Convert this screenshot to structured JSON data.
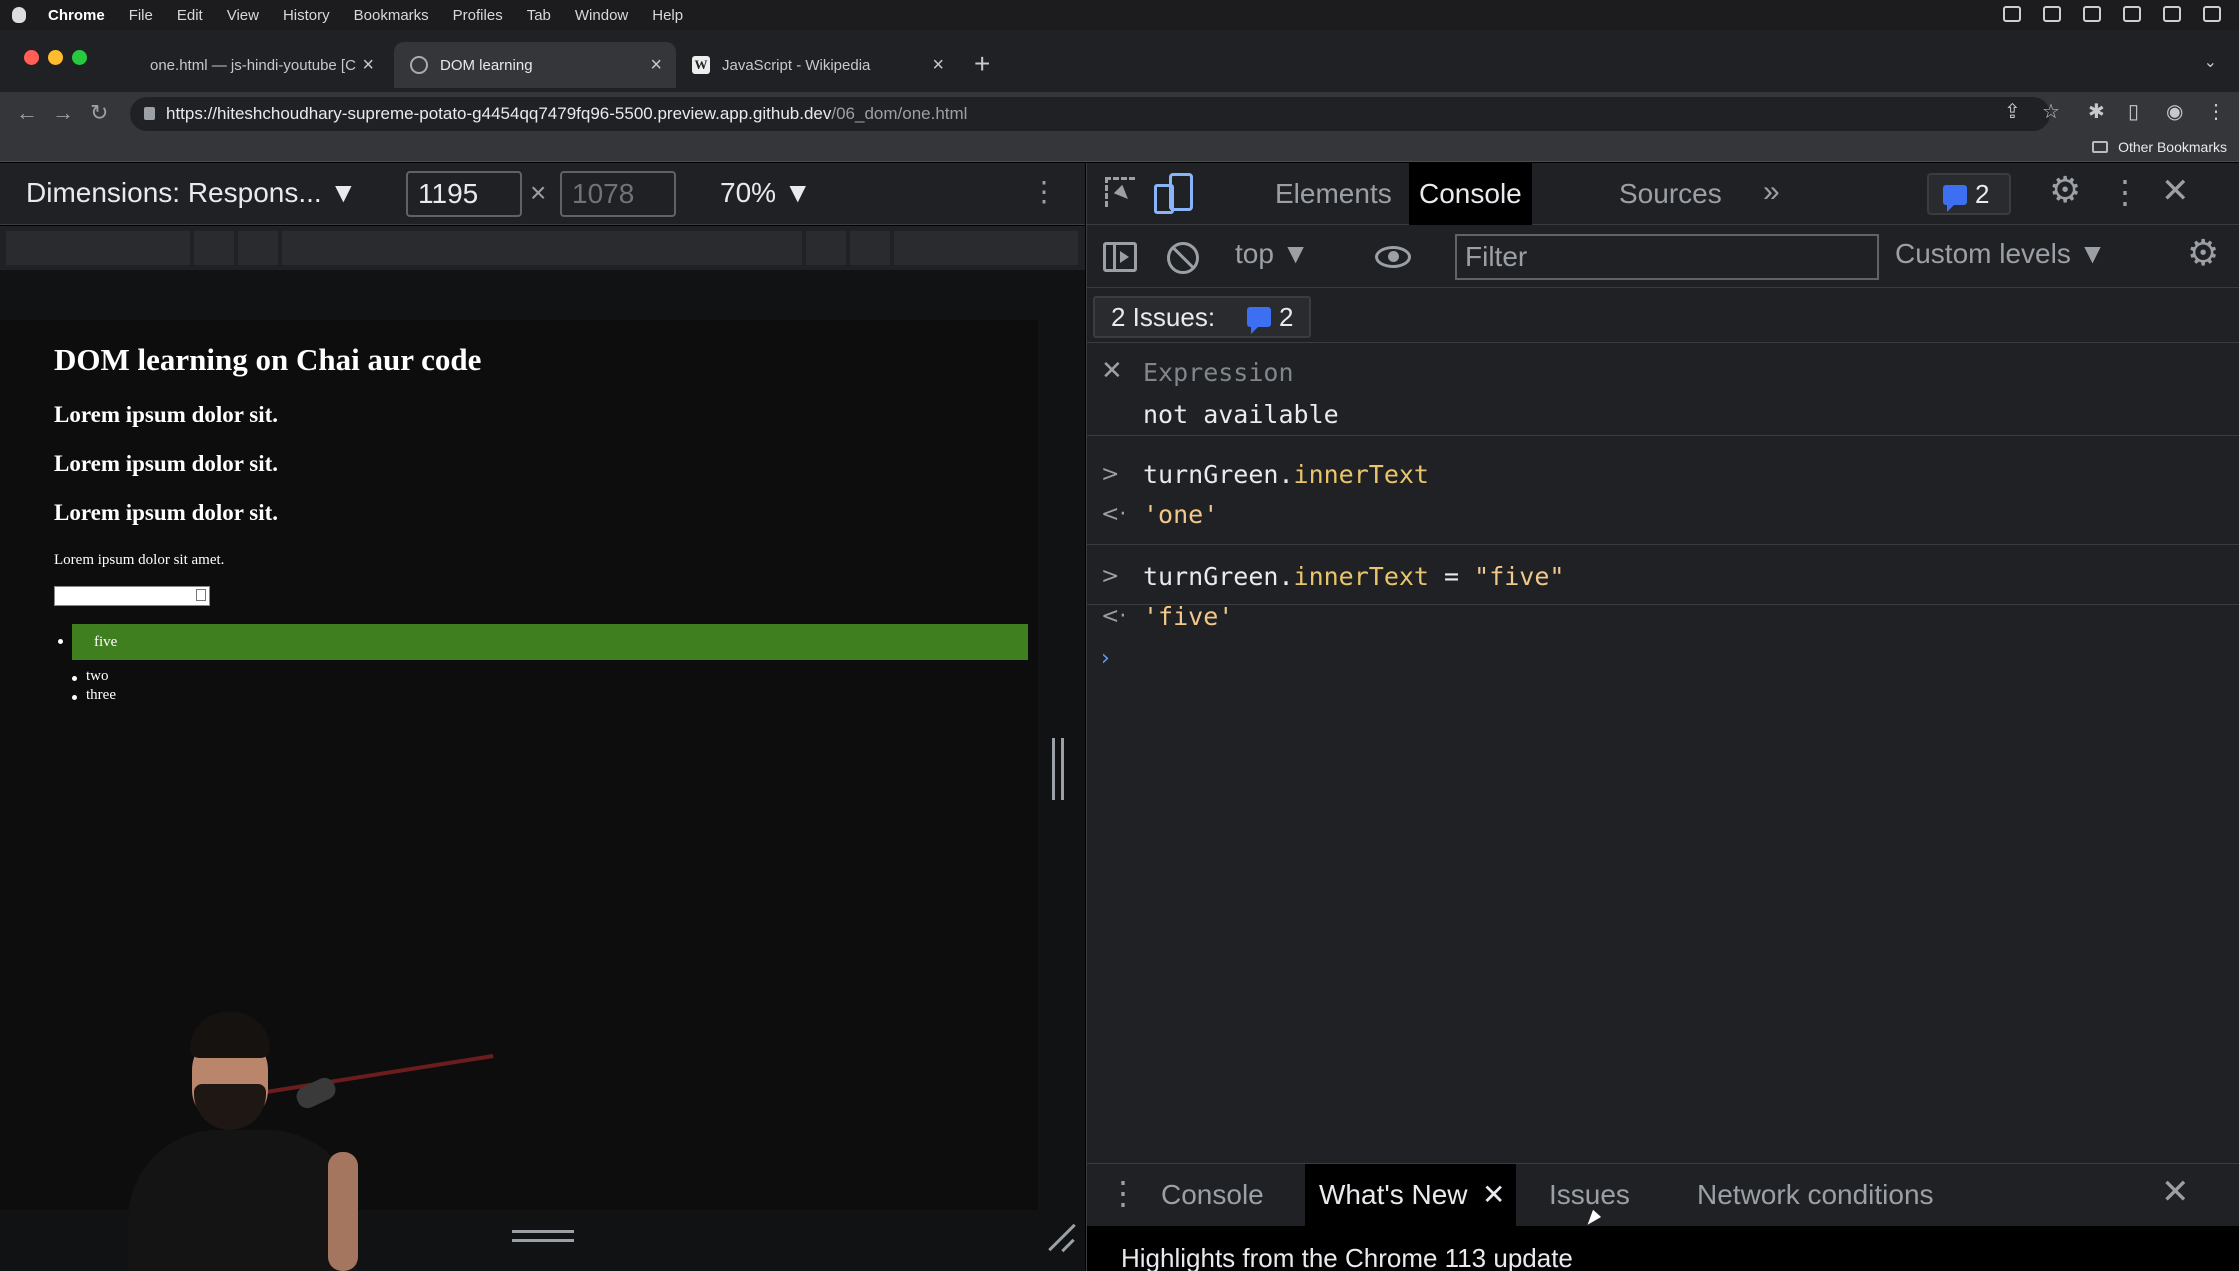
{
  "menubar": {
    "items": [
      "Chrome",
      "File",
      "Edit",
      "View",
      "History",
      "Bookmarks",
      "Profiles",
      "Tab",
      "Window",
      "Help"
    ]
  },
  "browser": {
    "tabs": [
      {
        "title": "one.html — js-hindi-youtube [C"
      },
      {
        "title": "DOM learning",
        "active": true
      },
      {
        "title": "JavaScript - Wikipedia"
      }
    ],
    "url": {
      "host": "https://hiteshchoudhary-supreme-potato-g4454qq7479fq96-5500.preview.app.github.dev",
      "path": "/06_dom/one.html"
    },
    "other_bookmarks": "Other Bookmarks"
  },
  "device_toolbar": {
    "dimensions_label": "Dimensions: Respons... ▼",
    "width": "1195",
    "height": "1078",
    "zoom": "70% ▼"
  },
  "page": {
    "heading": "DOM learning on Chai aur code",
    "subheadings": [
      "Lorem ipsum dolor sit.",
      "Lorem ipsum dolor sit.",
      "Lorem ipsum dolor sit."
    ],
    "paragraph": "Lorem ipsum dolor sit amet.",
    "list": [
      "five",
      "two",
      "three"
    ],
    "highlight_color": "#3f7f20"
  },
  "devtools": {
    "tabs": [
      "Elements",
      "Console",
      "Sources"
    ],
    "active_tab": "Console",
    "more_tabs": "»",
    "issues_count": "2",
    "context": "top ▼",
    "filter_placeholder": "Filter",
    "levels": "Custom levels ▼",
    "issues_label": "2 Issues:",
    "issues_badge_count": "2",
    "live_expression": {
      "placeholder": "Expression",
      "value": "not available"
    },
    "console": [
      {
        "input": {
          "obj": "turnGreen.",
          "prop": "innerText",
          "rest": ""
        },
        "output": "'one'"
      },
      {
        "input": {
          "obj": "turnGreen.",
          "prop": "innerText",
          "rest": " = ",
          "str": "\"five\""
        },
        "output": "'five'"
      }
    ],
    "drawer": {
      "tabs": [
        "Console",
        "What's New",
        "Issues",
        "Network conditions"
      ],
      "active_tab": "What's New",
      "content": "Highlights from the Chrome 113 update"
    }
  },
  "colors": {
    "accent_blue": "#8ab4f8",
    "badge_blue": "#3d6ff2"
  }
}
